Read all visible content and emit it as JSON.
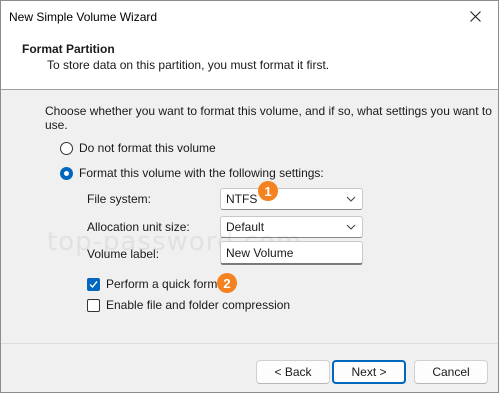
{
  "window": {
    "title": "New Simple Volume Wizard"
  },
  "header": {
    "title": "Format Partition",
    "subtitle": "To store data on this partition, you must format it first."
  },
  "main": {
    "intro": "Choose whether you want to format this volume, and if so, what settings you want to use.",
    "radio_no_format": {
      "label": "Do not format this volume",
      "checked": false
    },
    "radio_format": {
      "label": "Format this volume with the following settings:",
      "checked": true
    },
    "file_system": {
      "label": "File system:",
      "value": "NTFS"
    },
    "allocation_unit": {
      "label": "Allocation unit size:",
      "value": "Default"
    },
    "volume_label": {
      "label": "Volume label:",
      "value": "New Volume"
    },
    "quick_format": {
      "label": "Perform a quick format",
      "checked": true
    },
    "compression": {
      "label": "Enable file and folder compression",
      "checked": false
    }
  },
  "annotations": {
    "badge1": "1",
    "badge2": "2",
    "badge_color": "#f58220"
  },
  "watermark": "top-password.com",
  "buttons": {
    "back": "< Back",
    "next": "Next >",
    "cancel": "Cancel"
  },
  "colors": {
    "accent": "#0067c0"
  }
}
